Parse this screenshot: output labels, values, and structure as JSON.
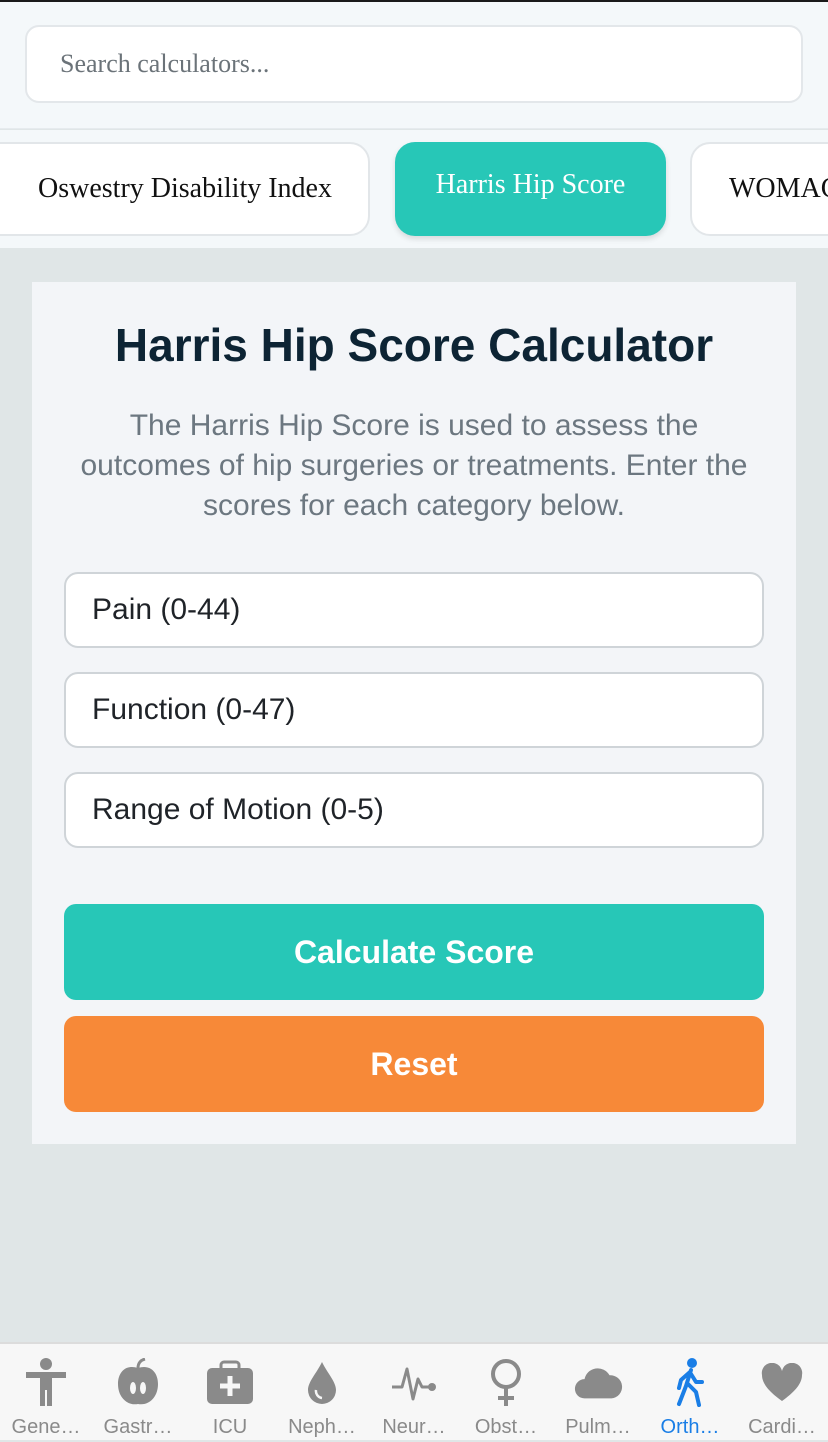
{
  "search": {
    "placeholder": "Search calculators..."
  },
  "chips": [
    {
      "label": "Oswestry Disability Index",
      "active": false
    },
    {
      "label": "Harris Hip Score",
      "active": true
    },
    {
      "label": "WOMAC",
      "active": false
    }
  ],
  "calculator": {
    "title": "Harris Hip Score Calculator",
    "description": "The Harris Hip Score is used to assess the outcomes of hip surgeries or treatments. Enter the scores for each category below.",
    "fields": [
      {
        "placeholder": "Pain (0-44)",
        "value": ""
      },
      {
        "placeholder": "Function (0-47)",
        "value": ""
      },
      {
        "placeholder": "Range of Motion (0-5)",
        "value": ""
      }
    ],
    "calculate_label": "Calculate Score",
    "reset_label": "Reset"
  },
  "tabs": [
    {
      "label": "Gene…",
      "icon": "person-icon"
    },
    {
      "label": "Gastr…",
      "icon": "stomach-icon"
    },
    {
      "label": "ICU",
      "icon": "medical-kit-icon"
    },
    {
      "label": "Neph…",
      "icon": "drop-icon"
    },
    {
      "label": "Neur…",
      "icon": "pulse-icon"
    },
    {
      "label": "Obst…",
      "icon": "female-icon"
    },
    {
      "label": "Pulm…",
      "icon": "cloud-icon"
    },
    {
      "label": "Orth…",
      "icon": "walking-icon",
      "active": true
    },
    {
      "label": "Cardi…",
      "icon": "heart-icon"
    }
  ],
  "colors": {
    "accent": "#27c7b7",
    "reset": "#f78938",
    "active_tab": "#1a7ee6",
    "inactive_tab": "#8a8a8a"
  }
}
